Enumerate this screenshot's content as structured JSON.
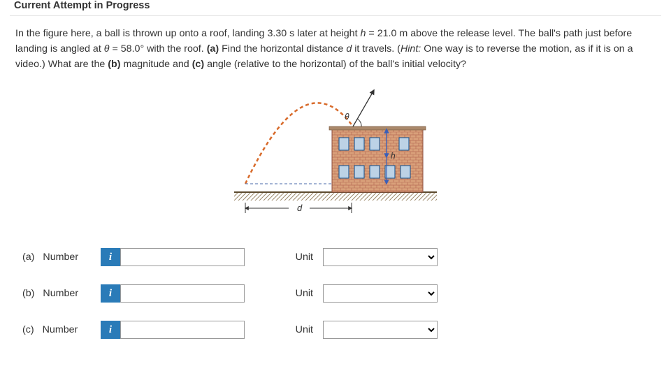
{
  "header": "Current Attempt in Progress",
  "problem": {
    "part1": "In the figure here, a ball is thrown up onto a roof, landing 3.30 s later at height ",
    "hVar": "h",
    "hEq": " = 21.0 m above the release level. The ball's path just before landing is angled at ",
    "thetaVar": "θ",
    "thetaEq": " = 58.0° with the roof. ",
    "aBold": "(a)",
    "aText": " Find the horizontal distance ",
    "dVar": "d",
    "aRest": " it travels. (",
    "hintLabel": "Hint:",
    "hintText": " One way is to reverse the motion, as if it is on a video.) What are the ",
    "bBold": "(b)",
    "bText": " magnitude and ",
    "cBold": "(c)",
    "cText": " angle (relative to the horizontal) of the ball's initial velocity?"
  },
  "figure": {
    "theta": "θ",
    "h": "h",
    "d": "d"
  },
  "answers": {
    "a": {
      "part": "(a)",
      "label": "Number",
      "unit": "Unit"
    },
    "b": {
      "part": "(b)",
      "label": "Number",
      "unit": "Unit"
    },
    "c": {
      "part": "(c)",
      "label": "Number",
      "unit": "Unit"
    }
  }
}
